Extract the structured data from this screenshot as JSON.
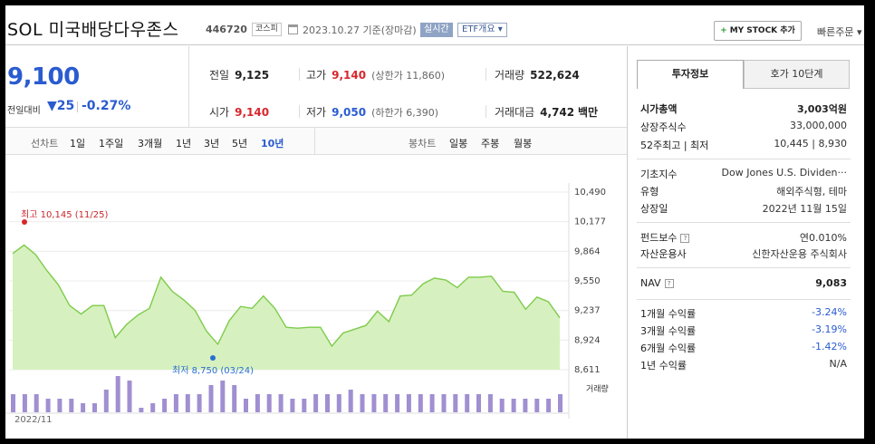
{
  "header": {
    "title": "SOL 미국배당다우존스",
    "code": "446720",
    "market": "코스피",
    "date": "2023.10.27 기준(장마감)",
    "live": "실시간",
    "etf": "ETF개요",
    "mystock": "MY STOCK 추가",
    "quick": "빠른주문"
  },
  "price": {
    "current": "9,100",
    "change_label": "전일대비",
    "change": "▼25",
    "change_pct": "-0.27%"
  },
  "stats": {
    "prev_label": "전일",
    "prev": "9,125",
    "high_label": "고가",
    "high": "9,140",
    "upper_limit_text": "(상한가 11,860)",
    "volume_label": "거래량",
    "volume": "522,624",
    "open_label": "시가",
    "open": "9,140",
    "low_label": "저가",
    "low": "9,050",
    "lower_limit_text": "(하한가 6,390)",
    "amount_label": "거래대금",
    "amount": "4,742",
    "amount_unit": "백만"
  },
  "chart_tabs": {
    "line_label": "선차트",
    "periods": [
      "1일",
      "1주일",
      "3개월",
      "1년",
      "3년",
      "5년",
      "10년"
    ],
    "active": "10년",
    "candle_label": "봉차트",
    "candles": [
      "일봉",
      "주봉",
      "월봉"
    ]
  },
  "chart_data": {
    "type": "area",
    "x_start_label": "2022/11",
    "y_ticks": [
      10490,
      10177,
      9864,
      9550,
      9237,
      8924,
      8611
    ],
    "y_tick_labels": [
      "10,490",
      "10,177",
      "9,864",
      "9,550",
      "9,237",
      "8,924",
      "8,611"
    ],
    "ylim": [
      8611,
      10490
    ],
    "high_annotation": "최고 10,145 (11/25)",
    "low_annotation": "최저 8,750 (03/24)",
    "high_index": 1,
    "low_index": 18,
    "values": [
      9840,
      9930,
      9830,
      9660,
      9510,
      9290,
      9200,
      9290,
      9290,
      8950,
      9090,
      9190,
      9260,
      9590,
      9440,
      9350,
      9240,
      9020,
      8880,
      9130,
      9280,
      9260,
      9390,
      9260,
      9060,
      9050,
      9060,
      9060,
      8860,
      9000,
      9040,
      9080,
      9230,
      9120,
      9390,
      9400,
      9520,
      9580,
      9560,
      9480,
      9590,
      9590,
      9600,
      9440,
      9430,
      9250,
      9380,
      9330,
      9160
    ],
    "volume_label": "거래량",
    "volumes": [
      4,
      4,
      4,
      3,
      3,
      3,
      2,
      2,
      5,
      8,
      7,
      1,
      2,
      3,
      4,
      4,
      4,
      6,
      7,
      6,
      3,
      4,
      4,
      4,
      3,
      3,
      4,
      4,
      4,
      5,
      4,
      4,
      4,
      4,
      4,
      4,
      4,
      4,
      4,
      4,
      4,
      4,
      3,
      3,
      3,
      3,
      3,
      4
    ],
    "grid": true,
    "line_color": "#7ecb4a",
    "fill_color": "#d6f1bf"
  },
  "info_panel": {
    "tab1": "투자정보",
    "tab2": "호가 10단계",
    "rows1": [
      {
        "k": "시가총액",
        "v": "3,003억원"
      },
      {
        "k": "상장주식수",
        "v": "33,000,000"
      },
      {
        "k": "52주최고 | 최저",
        "v": "10,445 | 8,930"
      }
    ],
    "rows2": [
      {
        "k": "기초지수",
        "v": "Dow Jones U.S. Dividen···"
      },
      {
        "k": "유형",
        "v": "해외주식형, 테마"
      },
      {
        "k": "상장일",
        "v": "2022년 11월 15일"
      }
    ],
    "rows3": [
      {
        "k": "펀드보수",
        "v": "연0.010%"
      },
      {
        "k": "자산운용사",
        "v": "신한자산운용 주식회사"
      }
    ],
    "nav": {
      "k": "NAV",
      "v": "9,083"
    },
    "returns": [
      {
        "k": "1개월 수익률",
        "v": "-3.24%"
      },
      {
        "k": "3개월 수익률",
        "v": "-3.19%"
      },
      {
        "k": "6개월 수익률",
        "v": "-1.42%"
      },
      {
        "k": "1년 수익률",
        "v": "N/A"
      }
    ]
  }
}
